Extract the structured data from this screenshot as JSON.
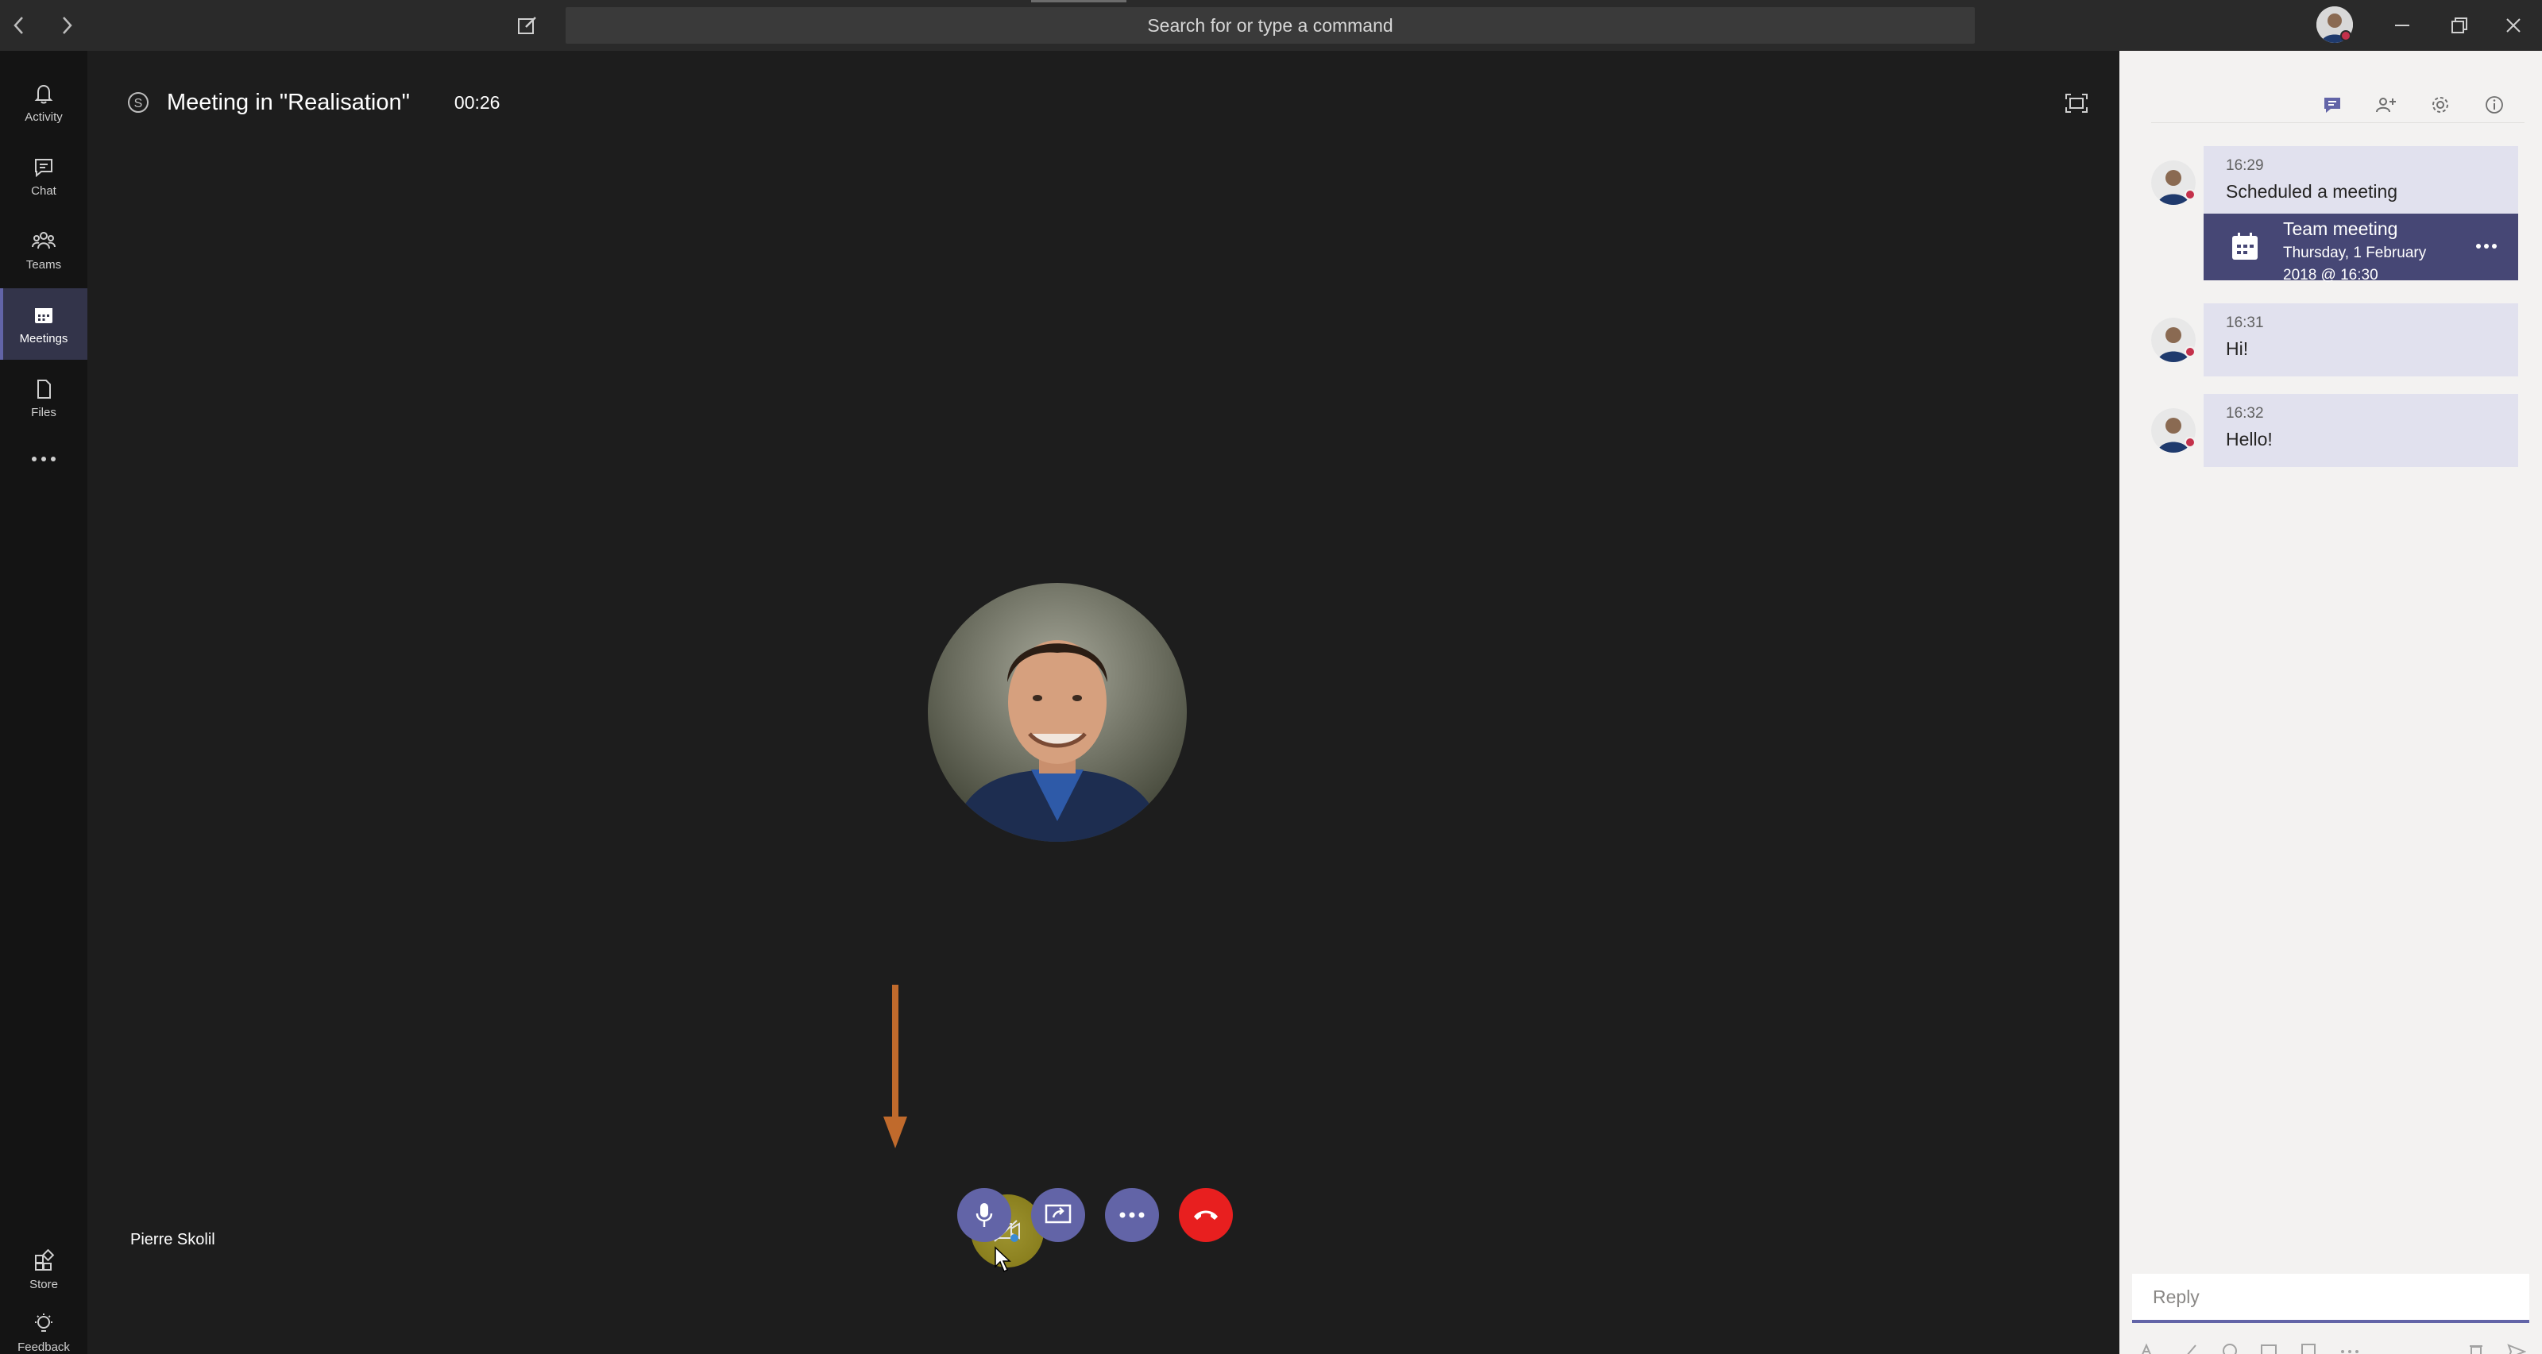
{
  "titlebar": {
    "search_placeholder": "Search for or type a command"
  },
  "rail": {
    "items": [
      {
        "label": "Activity",
        "icon": "bell-icon"
      },
      {
        "label": "Chat",
        "icon": "chat-icon"
      },
      {
        "label": "Teams",
        "icon": "teams-icon"
      },
      {
        "label": "Meetings",
        "icon": "calendar-icon",
        "active": true
      },
      {
        "label": "Files",
        "icon": "file-icon"
      }
    ],
    "bottom_items": [
      {
        "label": "Store",
        "icon": "store-icon"
      },
      {
        "label": "Feedback",
        "icon": "bulb-icon"
      }
    ]
  },
  "meeting": {
    "title": "Meeting in \"Realisation\"",
    "duration": "00:26",
    "participant_name": "Pierre Skolil"
  },
  "controls": [
    "camera-toggle",
    "microphone",
    "share-screen",
    "more-actions",
    "hang-up"
  ],
  "chat": {
    "messages": [
      {
        "time": "16:29",
        "text": "Scheduled a meeting"
      },
      {
        "time": "16:31",
        "text": "Hi!"
      },
      {
        "time": "16:32",
        "text": "Hello!"
      }
    ],
    "card": {
      "title": "Team meeting",
      "date": "Thursday, 1 February 2018 @ 16:30"
    },
    "reply_placeholder": "Reply"
  },
  "colors": {
    "accent": "#6264a7",
    "hangup": "#e81f1f",
    "status": "#c4314b",
    "card": "#464775"
  }
}
